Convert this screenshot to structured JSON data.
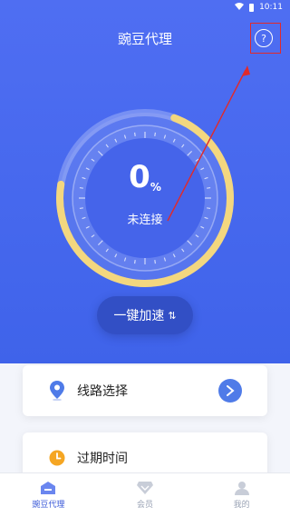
{
  "status": {
    "time": "10:11"
  },
  "header": {
    "title": "豌豆代理",
    "help_icon_label": "?"
  },
  "dial": {
    "percent": "0",
    "unit": "%",
    "state": "未连接",
    "progress": 0.72
  },
  "boost_button": {
    "label": "一键加速",
    "arrow": "⇅"
  },
  "cards": [
    {
      "label": "线路选择",
      "icon": "location-pin-icon"
    },
    {
      "label": "过期时间",
      "icon": "clock-icon"
    }
  ],
  "colors": {
    "accent": "#4f6ef2",
    "ring": "#f3d77f",
    "annotation": "#e12a2a"
  },
  "tabs": [
    {
      "label": "豌豆代理",
      "icon": "home-icon",
      "active": true
    },
    {
      "label": "会员",
      "icon": "vip-diamond-icon",
      "active": false
    },
    {
      "label": "我的",
      "icon": "user-icon",
      "active": false
    }
  ]
}
